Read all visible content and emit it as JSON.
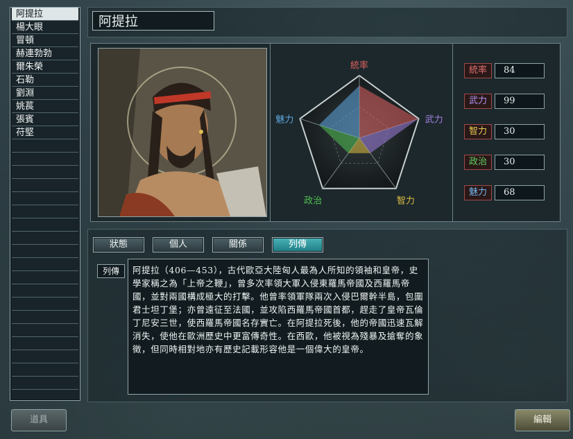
{
  "characters": [
    {
      "name": "阿提拉",
      "selected": true
    },
    {
      "name": "楊大眼"
    },
    {
      "name": "冒頓"
    },
    {
      "name": "赫連勃勃"
    },
    {
      "name": "爾朱榮"
    },
    {
      "name": "石勒"
    },
    {
      "name": "劉淵"
    },
    {
      "name": "姚萇"
    },
    {
      "name": "張賓"
    },
    {
      "name": "苻堅"
    }
  ],
  "selected_name": "阿提拉",
  "radar": {
    "axes": [
      "統率",
      "武力",
      "智力",
      "政治",
      "魅力"
    ]
  },
  "stats": [
    {
      "label": "統率",
      "value": "84"
    },
    {
      "label": "武力",
      "value": "99"
    },
    {
      "label": "智力",
      "value": "30"
    },
    {
      "label": "政治",
      "value": "30"
    },
    {
      "label": "魅力",
      "value": "68"
    }
  ],
  "tabs": [
    "狀態",
    "個人",
    "關係",
    "列傳"
  ],
  "active_tab": "列傳",
  "bio": {
    "label": "列傳",
    "text": "阿提拉（406—453），古代歐亞大陸匈人最為人所知的領袖和皇帝，史學家稱之為「上帝之鞭」，曾多次率領大軍入侵東羅馬帝國及西羅馬帝國，並對兩國構成極大的打擊。他曾率領軍隊兩次入侵巴爾幹半島，包圍君士坦丁堡；亦曾遠征至法國，並攻陷西羅馬帝國首都，趕走了皇帝瓦倫丁尼安三世，使西羅馬帝國名存實亡。在阿提拉死後，他的帝國迅速瓦解消失，使他在歐洲歷史中更富傳奇性。在西歐，他被視為殘暴及搶奪的象徵，但同時相對地亦有歷史記載形容他是一個偉大的皇帝。"
  },
  "buttons": {
    "items": "道具",
    "edit": "編輯"
  },
  "colors": {
    "stat_border": "#a04a4a",
    "active_tab": "#2a9aa0",
    "radar_axis_tongshuai": "#e06060",
    "radar_axis_wuli": "#a080e0",
    "radar_axis_zhili": "#e0c040",
    "radar_axis_zhengzhi": "#50c050",
    "radar_axis_meili": "#60a8e0"
  }
}
